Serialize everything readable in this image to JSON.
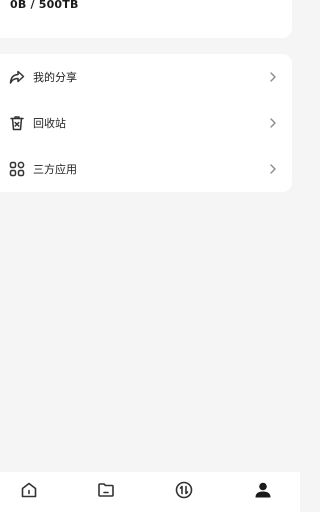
{
  "storage": {
    "usage_text": "0B / 500TB"
  },
  "menu": {
    "items": [
      {
        "label": "我的分享",
        "icon": "share-icon"
      },
      {
        "label": "回收站",
        "icon": "trash-icon"
      },
      {
        "label": "三方应用",
        "icon": "apps-grid-icon"
      }
    ]
  },
  "tabbar": {
    "tabs": [
      {
        "icon": "home-icon",
        "active": false
      },
      {
        "icon": "folder-icon",
        "active": false
      },
      {
        "icon": "transfer-icon",
        "active": false
      },
      {
        "icon": "profile-icon",
        "active": true
      }
    ]
  },
  "colors": {
    "background": "#f5f5f5",
    "card": "#ffffff",
    "text": "#222222",
    "icon": "#333333",
    "chevron": "#8a8a8a"
  }
}
